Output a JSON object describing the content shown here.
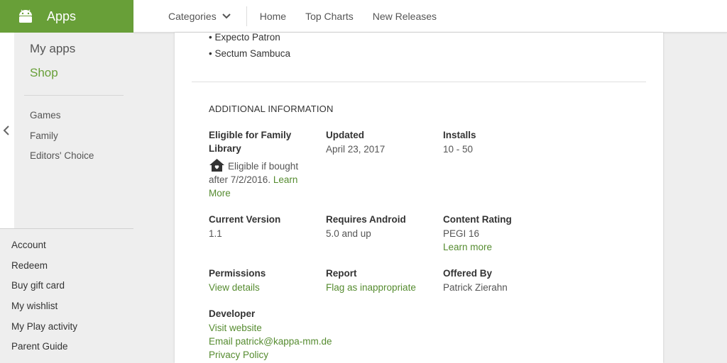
{
  "brand": {
    "label": "Apps",
    "icon": "android-icon"
  },
  "topnav": {
    "categories_label": "Categories",
    "links": [
      "Home",
      "Top Charts",
      "New Releases"
    ]
  },
  "sidebar": {
    "primary": {
      "my_apps": "My apps",
      "shop": "Shop"
    },
    "sub_items": [
      "Games",
      "Family",
      "Editors' Choice"
    ],
    "secondary_items": [
      "Account",
      "Redeem",
      "Buy gift card",
      "My wishlist",
      "My Play activity",
      "Parent Guide"
    ]
  },
  "main": {
    "bullets": [
      "• Expecto Patron",
      "• Sectum Sambuca"
    ],
    "section_title": "ADDITIONAL INFORMATION",
    "family_library": {
      "label_line1": "Eligible for Family",
      "label_line2": "Library",
      "text_line1": "Eligible if bought",
      "text_line2_prefix": "after 7/2/2016.",
      "learn": "Learn",
      "more": "More"
    },
    "updated": {
      "label": "Updated",
      "value": "April 23, 2017"
    },
    "installs": {
      "label": "Installs",
      "value": "10 - 50"
    },
    "current_version": {
      "label": "Current Version",
      "value": "1.1"
    },
    "requires_android": {
      "label": "Requires Android",
      "value": "5.0 and up"
    },
    "content_rating": {
      "label": "Content Rating",
      "value": "PEGI 16",
      "link": "Learn more"
    },
    "permissions": {
      "label": "Permissions",
      "link": "View details"
    },
    "report": {
      "label": "Report",
      "link": "Flag as inappropriate"
    },
    "offered_by": {
      "label": "Offered By",
      "value": "Patrick Zierahn"
    },
    "developer": {
      "label": "Developer",
      "links": [
        "Visit website",
        "Email patrick@kappa-mm.de",
        "Privacy Policy"
      ]
    }
  },
  "colors": {
    "brand_green": "#689f38",
    "link_green": "#558b2f"
  }
}
